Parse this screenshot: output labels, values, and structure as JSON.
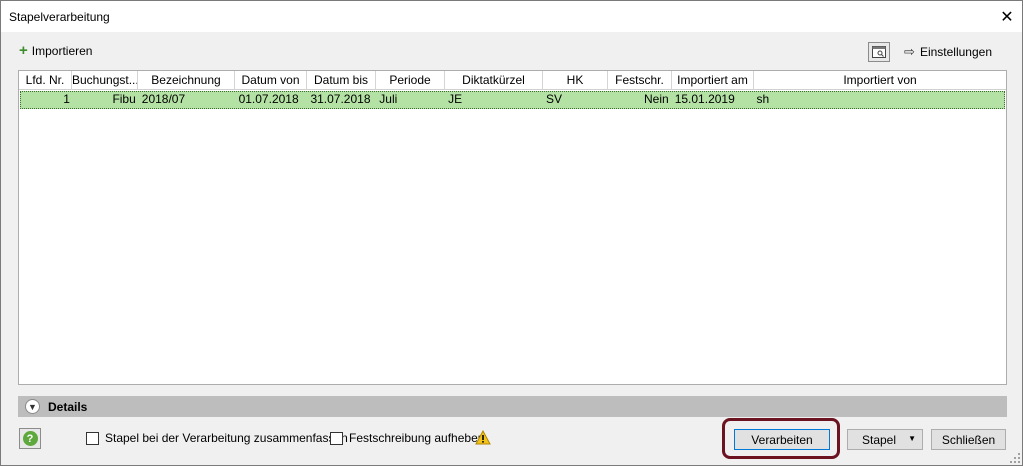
{
  "window": {
    "title": "Stapelverarbeitung"
  },
  "toolbar": {
    "import_label": "Importieren",
    "settings_label": "Einstellungen"
  },
  "grid": {
    "columns": [
      "Lfd. Nr.",
      "Buchungst...",
      "Bezeichnung",
      "Datum von",
      "Datum bis",
      "Periode",
      "Diktatkürzel",
      "HK",
      "Festschr.",
      "Importiert am",
      "Importiert von"
    ],
    "rows": [
      [
        "1",
        "Fibu",
        "2018/07",
        "01.07.2018",
        "31.07.2018",
        "Juli",
        "JE",
        "SV",
        "Nein",
        "15.01.2019",
        "sh"
      ]
    ]
  },
  "details": {
    "label": "Details"
  },
  "footer": {
    "merge_label": "Stapel bei der Verarbeitung zusammenfassen",
    "unlock_label": "Festschreibung aufheben",
    "process_label": "Verarbeiten",
    "batch_label": "Stapel",
    "close_label": "Schließen"
  },
  "colors": {
    "row_selected": "#b4e2a4",
    "highlight_ring": "#6b1320",
    "details_bar": "#bdbdbd"
  }
}
